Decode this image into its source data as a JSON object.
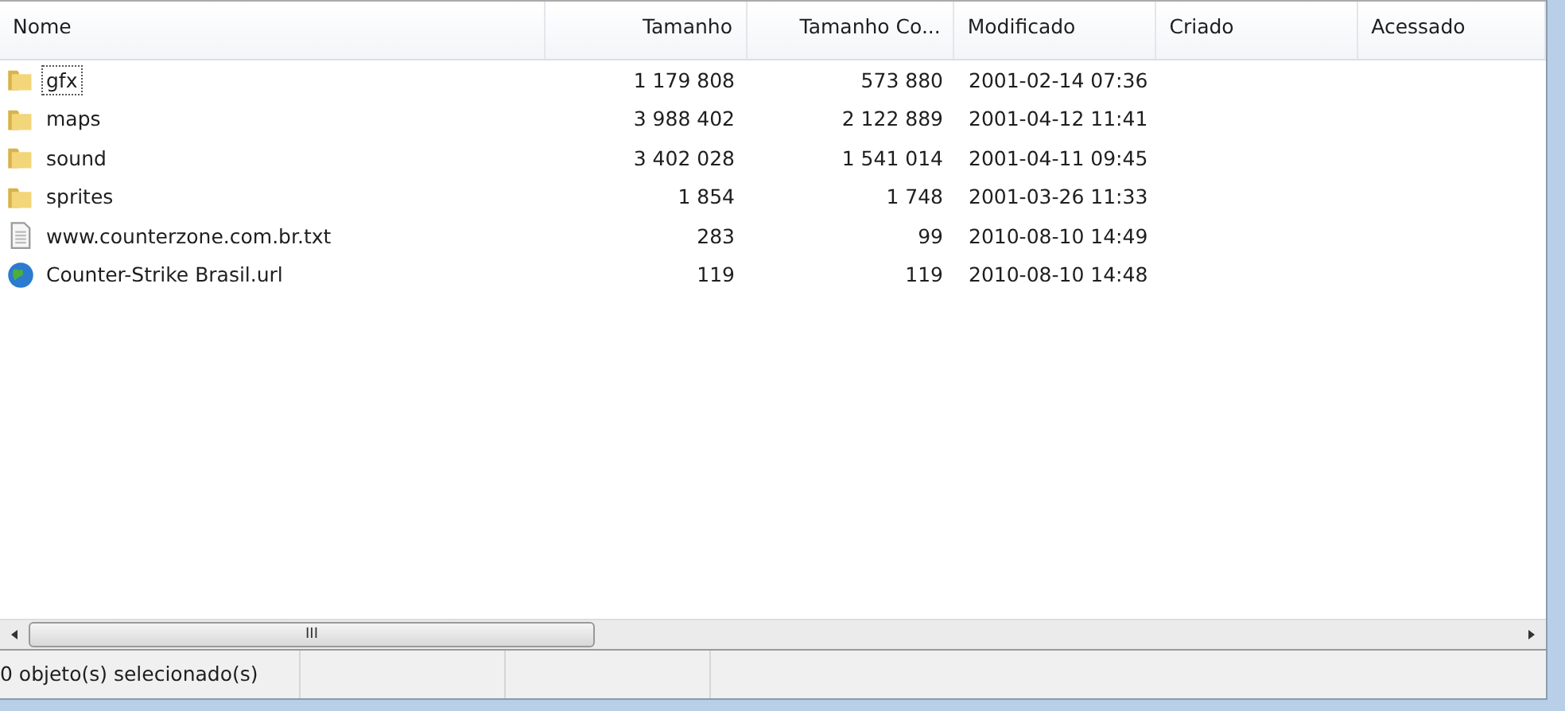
{
  "columns": [
    "Nome",
    "Tamanho",
    "Tamanho Co...",
    "Modificado",
    "Criado",
    "Acessado"
  ],
  "rows": [
    {
      "kind": "folder",
      "name": "gfx",
      "size": "1 179 808",
      "packed": "573 880",
      "modified": "2001-02-14 07:36",
      "focused": true
    },
    {
      "kind": "folder",
      "name": "maps",
      "size": "3 988 402",
      "packed": "2 122 889",
      "modified": "2001-04-12 11:41",
      "focused": false
    },
    {
      "kind": "folder",
      "name": "sound",
      "size": "3 402 028",
      "packed": "1 541 014",
      "modified": "2001-04-11 09:45",
      "focused": false
    },
    {
      "kind": "folder",
      "name": "sprites",
      "size": "1 854",
      "packed": "1 748",
      "modified": "2001-03-26 11:33",
      "focused": false
    },
    {
      "kind": "text",
      "name": "www.counterzone.com.br.txt",
      "size": "283",
      "packed": "99",
      "modified": "2010-08-10 14:49",
      "focused": false
    },
    {
      "kind": "url",
      "name": "Counter-Strike Brasil.url",
      "size": "119",
      "packed": "119",
      "modified": "2010-08-10 14:48",
      "focused": false
    }
  ],
  "scrollbar_grip": "III",
  "status_bar": "0 objeto(s) selecionado(s)"
}
